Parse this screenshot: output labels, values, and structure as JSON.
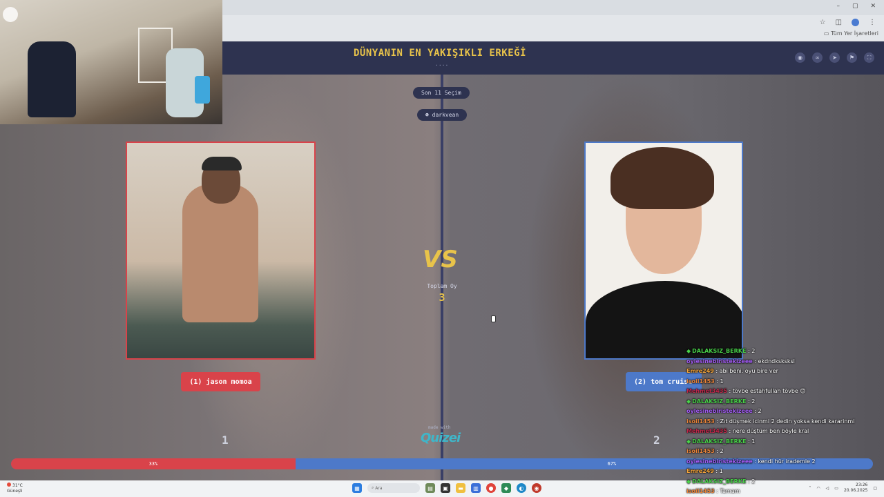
{
  "browser": {
    "window_controls": [
      "–",
      "▢",
      "✕"
    ],
    "bookmarks_label": "Tüm Yer İşaretleri"
  },
  "header": {
    "title": "DÜNYANIN EN YAKIŞIKLI ERKEĞİ",
    "dots": "...."
  },
  "stage": {
    "last_choice_label": "Son 11 Seçim",
    "user_label": "darkvean",
    "vs_label": "VS",
    "total_votes_label": "Toplam Oy",
    "total_votes_value": "3"
  },
  "contenders": [
    {
      "choice_label": "(1) jason momoa",
      "score": "1",
      "percent": "33%",
      "percent_value": 33,
      "color": "#d9434a"
    },
    {
      "choice_label": "(2) tom cruise",
      "score": "2",
      "percent": "67%",
      "percent_value": 67,
      "color": "#4d79c9"
    }
  ],
  "branding": {
    "made_with": "made with",
    "logo": "Quizei"
  },
  "chat": [
    {
      "user": "DALAKSIZ_BERKE",
      "color": "#49d14a",
      "badge": true,
      "text": ": 2"
    },
    {
      "user": "oylesinebiristekizeee",
      "color": "#a35cf5",
      "badge": false,
      "text": ": ekdndksksksl"
    },
    {
      "user": "Emre249",
      "color": "#f2a33a",
      "badge": false,
      "text": ": abi beni. oyu bire ver"
    },
    {
      "user": "isoil1453",
      "color": "#e8833a",
      "badge": false,
      "text": ": 1"
    },
    {
      "user": "Mehmet3435",
      "color": "#c2274a",
      "badge": false,
      "text": ": tövbe estahfullah tövbe 😊"
    },
    {
      "user": "DALAKSIZ_BERKE",
      "color": "#49d14a",
      "badge": true,
      "text": ": 2"
    },
    {
      "user": "oylesinebiristekizeee",
      "color": "#a35cf5",
      "badge": false,
      "text": ": 2"
    },
    {
      "user": "isoil1453",
      "color": "#e8833a",
      "badge": false,
      "text": ": Zıt düşmek icinmi 2 dedin yoksa kendi kararinmi"
    },
    {
      "user": "Mehmet3435",
      "color": "#c2274a",
      "badge": false,
      "text": ": nere düştüm ben böyle kral"
    },
    {
      "user": "DALAKSIZ_BERKE",
      "color": "#49d14a",
      "badge": true,
      "text": ": 1"
    },
    {
      "user": "isoil1453",
      "color": "#e8833a",
      "badge": false,
      "text": ": 2"
    },
    {
      "user": "oylesinebiristekizeee",
      "color": "#a35cf5",
      "badge": false,
      "text": ": kendi hür irademle 2"
    },
    {
      "user": "Emre249",
      "color": "#f2a33a",
      "badge": false,
      "text": ": 1"
    },
    {
      "user": "DALAKSIZ_BERKE",
      "color": "#49d14a",
      "badge": true,
      "text": ": 2"
    },
    {
      "user": "isoil1453",
      "color": "#e8833a",
      "badge": false,
      "text": ": Tamam"
    }
  ],
  "taskbar": {
    "weather_temp": "31°C",
    "weather_desc": "Güneşli",
    "search_placeholder": "Ara",
    "time": "23:26",
    "date": "20.06.2025"
  }
}
